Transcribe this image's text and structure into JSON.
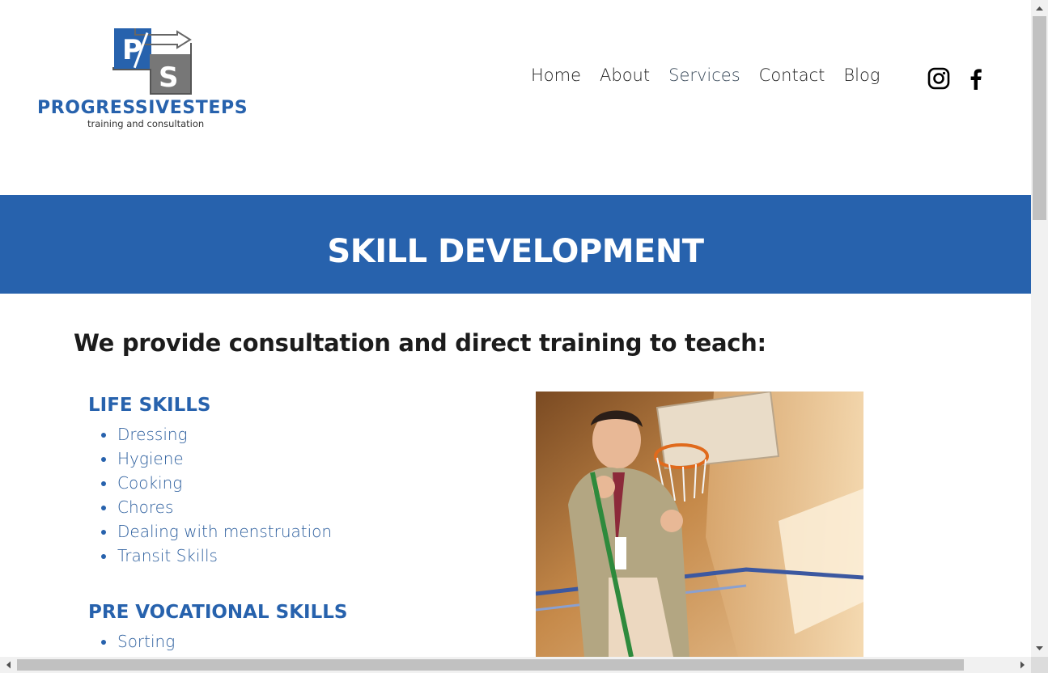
{
  "brand": {
    "mark_letters": [
      "P",
      "S"
    ],
    "name": "PROGRESSIVESTEPS",
    "tagline": "training and consultation"
  },
  "nav": {
    "items": [
      {
        "label": "Home"
      },
      {
        "label": "About"
      },
      {
        "label": "Services"
      },
      {
        "label": "Contact"
      },
      {
        "label": "Blog"
      }
    ]
  },
  "social": [
    "instagram-icon",
    "facebook-icon"
  ],
  "banner": {
    "title": "SKILL DEVELOPMENT"
  },
  "content": {
    "intro": "We provide consultation and direct training to teach:",
    "sections": [
      {
        "title": "LIFE SKILLS",
        "items": [
          "Dressing",
          "Hygiene",
          "Cooking",
          "Chores",
          "Dealing with menstruation",
          "Transit Skills"
        ]
      },
      {
        "title": "PRE VOCATIONAL SKILLS",
        "items": [
          "Sorting"
        ]
      }
    ]
  },
  "colors": {
    "brand_blue": "#2762ad",
    "text_dark": "#1c1c1c",
    "list_text": "#2d5f9e"
  }
}
